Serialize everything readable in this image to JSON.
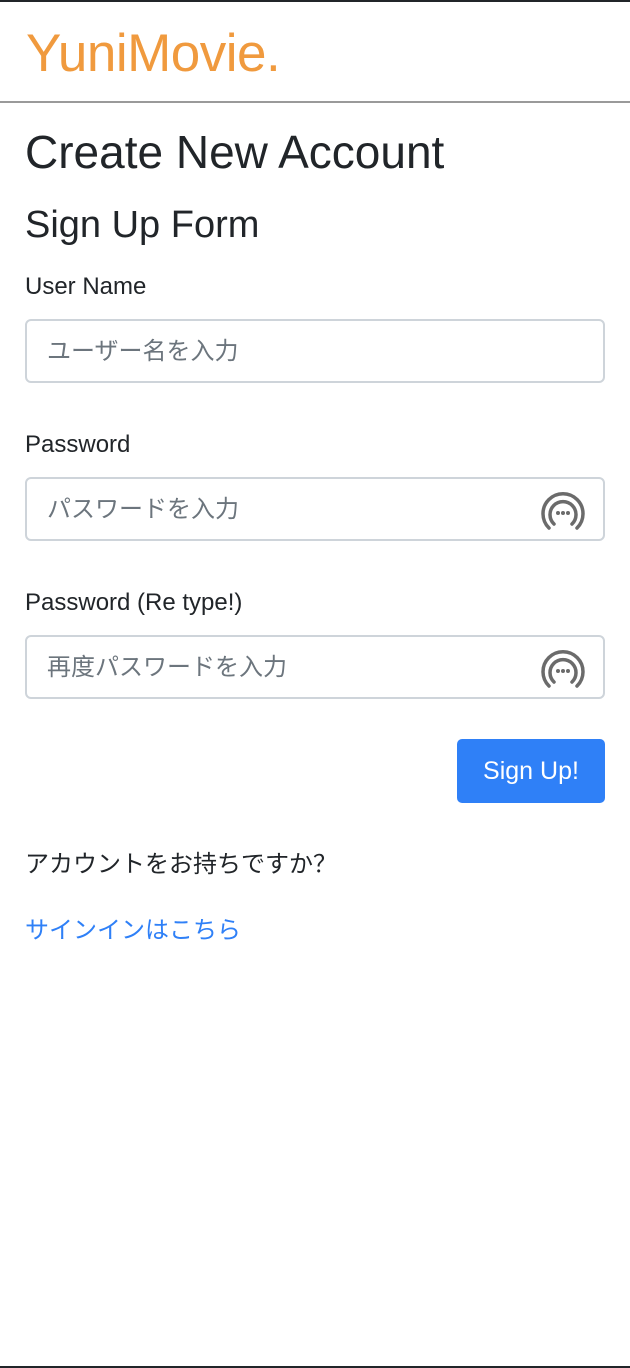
{
  "header": {
    "brand": "YuniMovie."
  },
  "main": {
    "page_title": "Create New Account",
    "form_title": "Sign Up Form"
  },
  "form": {
    "username": {
      "label": "User Name",
      "placeholder": "ユーザー名を入力",
      "value": ""
    },
    "password": {
      "label": "Password",
      "placeholder": "パスワードを入力",
      "value": "",
      "icon": "password-manager-icon"
    },
    "password_retype": {
      "label": "Password (Re type!)",
      "placeholder": "再度パスワードを入力",
      "value": "",
      "icon": "password-manager-icon"
    },
    "submit_label": "Sign Up!"
  },
  "footer": {
    "question": "アカウントをお持ちですか？",
    "signin_link": "サインインはこちら"
  },
  "colors": {
    "brand": "#f09a3e",
    "primary": "#2f80f7",
    "input_border": "#ced4da",
    "placeholder": "#6c757d"
  }
}
